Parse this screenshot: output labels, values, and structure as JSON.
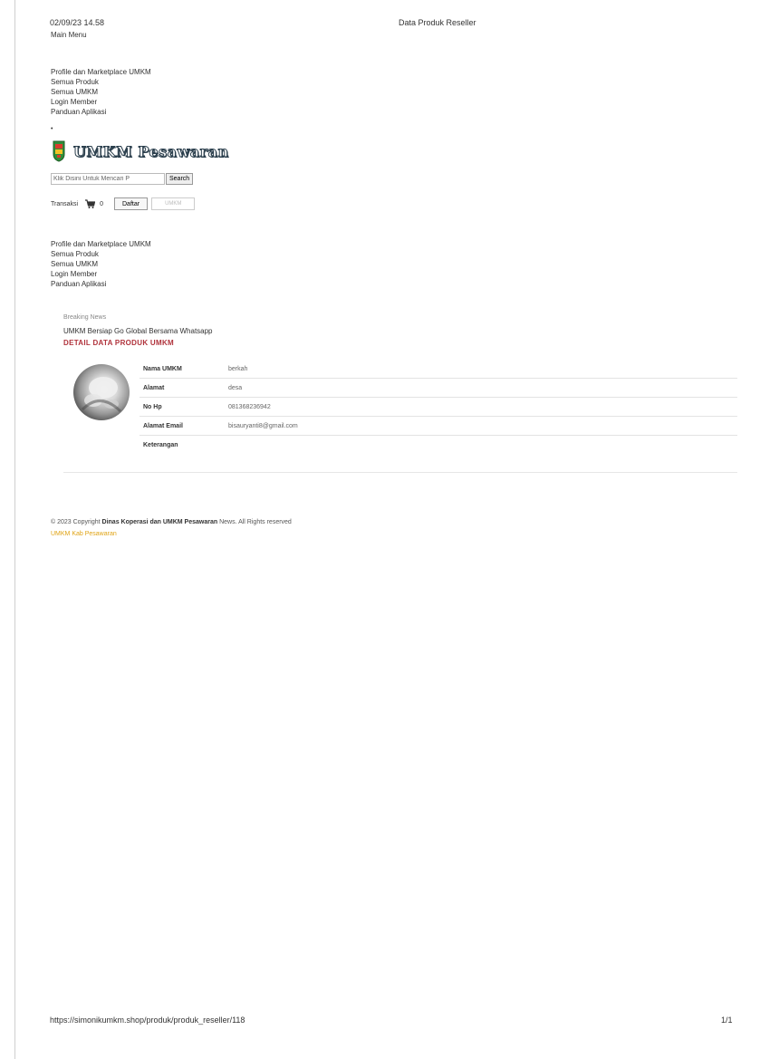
{
  "print_header": {
    "date": "02/09/23 14.58",
    "title": "Data Produk Reseller"
  },
  "print_footer": {
    "url": "https://simonikumkm.shop/produk/produk_reseller/118",
    "page": "1/1"
  },
  "main_menu_label": "Main Menu",
  "menu_items": [
    "Profile dan Marketplace UMKM",
    "Semua Produk",
    "Semua UMKM",
    "Login Member",
    "Panduan Aplikasi"
  ],
  "bullet": "•",
  "logo": {
    "name": "UMKM Pesawaran",
    "icon": "shield-icon"
  },
  "search": {
    "placeholder": "Klik Disini Untuk Mencari P",
    "button_label": "Search"
  },
  "transaction": {
    "label": "Transaksi",
    "cart_icon": "cart-icon",
    "cart_count": "0",
    "daftar_label": "Daftar",
    "umkm_label": "UMKM"
  },
  "breaking_news": {
    "label": "Breaking News",
    "text": "UMKM Bersiap Go Global Bersama Whatsapp"
  },
  "detail_title": "DETAIL DATA PRODUK UMKM",
  "detail": [
    {
      "label": "Nama UMKM",
      "value": "berkah"
    },
    {
      "label": "Alamat",
      "value": "desa"
    },
    {
      "label": "No Hp",
      "value": "081368236942"
    },
    {
      "label": "Alamat Email",
      "value": "bisauryanti8@gmail.com"
    },
    {
      "label": "Keterangan",
      "value": ""
    }
  ],
  "footer": {
    "copy_prefix": "© 2023 Copyright",
    "copy_org": "Dinas Koperasi dan UMKM Pesawaran",
    "copy_suffix": "News. All Rights reserved",
    "brand": "UMKM Kab Pesawaran"
  },
  "colors": {
    "detail_title": "#b0323b",
    "footer_brand": "#e0a416",
    "logo_stroke": "#2b3f4d"
  }
}
